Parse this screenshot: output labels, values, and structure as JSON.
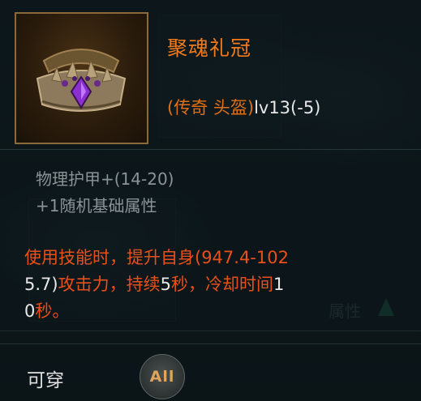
{
  "item": {
    "name": "聚魂礼冠",
    "type": "(传奇 头盔)",
    "level": "lv13(-5)",
    "icon": "crown-icon"
  },
  "stats": [
    "物理护甲+(14-20)",
    "+1随机基础属性"
  ],
  "description": {
    "line1": "使用技能时，提升自身(947.4-102",
    "line2a": "5.7)",
    "line2b": "攻击力，持续",
    "line2c": "5",
    "line2d": "秒，冷却时间",
    "line2e": "1",
    "line3a": "0",
    "line3b": "秒。"
  },
  "footer": {
    "wear_label": "可穿",
    "class_badge": "All"
  },
  "background": {
    "attr_label": "属性"
  },
  "colors": {
    "rarity": "#f07a1c",
    "effect_text": "#e8501a",
    "stat_text": "#8a9497"
  }
}
